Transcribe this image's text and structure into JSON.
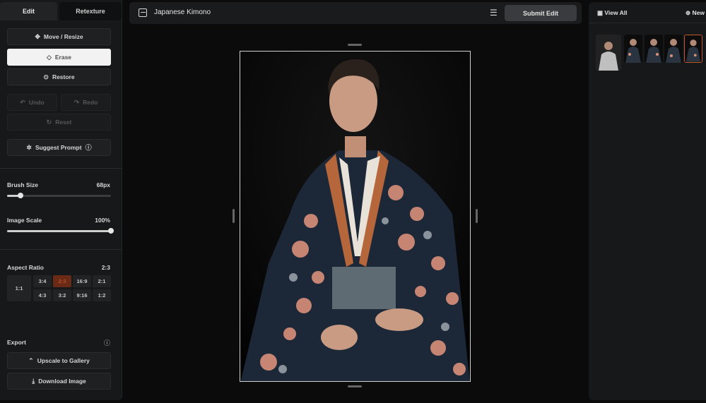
{
  "left_panel": {
    "tabs": [
      "Edit",
      "Retexture"
    ],
    "buttons": {
      "move_resize": "Move / Resize",
      "erase": "Erase",
      "restore": "Restore",
      "undo": "Undo",
      "redo": "Redo",
      "reset": "Reset",
      "suggest_prompt": "Suggest Prompt"
    },
    "brush_size": {
      "label": "Brush Size",
      "value": "68px",
      "fraction": 0.13
    },
    "image_scale": {
      "label": "Image Scale",
      "value": "100%",
      "fraction": 1.0
    },
    "aspect_ratio": {
      "label": "Aspect Ratio",
      "value": "2:3",
      "options": [
        "1:1",
        "3:4",
        "2:3",
        "16:9",
        "2:1",
        "4:3",
        "3:2",
        "9:16",
        "1:2"
      ],
      "selected": "2:3"
    },
    "export": {
      "label": "Export",
      "upscale": "Upscale to Gallery",
      "download": "Download Image"
    }
  },
  "center": {
    "title": "Japanese Kimono",
    "submit_label": "Submit Edit"
  },
  "right_panel": {
    "view_all": "View All",
    "new_label": "New"
  },
  "colors": {
    "accent": "#c4562c",
    "panel": "#17181a",
    "background": "#0b0b0c"
  }
}
